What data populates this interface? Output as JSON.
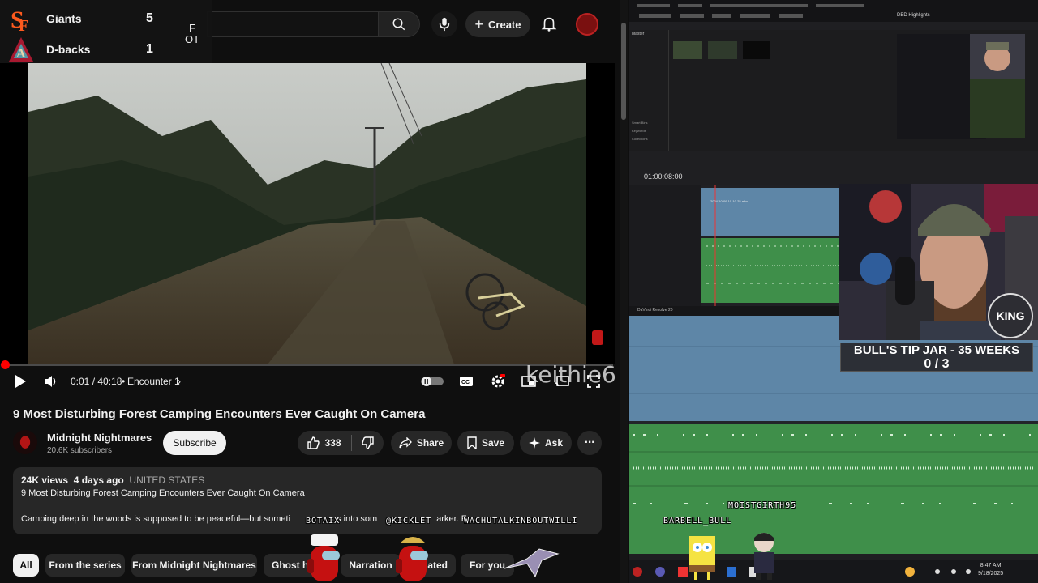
{
  "scoreboard": {
    "teams": [
      {
        "name": "Giants",
        "score": "5"
      },
      {
        "name": "D-backs",
        "score": "1"
      }
    ],
    "status_line1": "F",
    "status_line2": "OT"
  },
  "header": {
    "create_label": "Create"
  },
  "player": {
    "current_time": "0:01 / 40:18",
    "chapter": "Encounter 1",
    "progress_fraction": 0.0003,
    "watermark": "keithie6"
  },
  "video": {
    "title": "9 Most Disturbing Forest Camping Encounters Ever Caught On Camera",
    "channel_name": "Midnight Nightmares",
    "subscribers": "20.6K subscribers",
    "subscribe_label": "Subscribe",
    "likes": "338",
    "share_label": "Share",
    "save_label": "Save",
    "ask_label": "Ask"
  },
  "description": {
    "views": "24K views",
    "age": "4 days ago",
    "location": "UNITED STATES",
    "line2": "9 Most Disturbing Forest Camping Encounters Ever Caught On Camera",
    "line3_start": "Camping deep in the woods is supposed to be peaceful—but someti",
    "line3_mid": "s into som",
    "line3_end": "arker. F"
  },
  "chips": [
    "All",
    "From the series",
    "From Midnight Nightmares",
    "Ghost h",
    "Narration",
    "ated",
    "For you"
  ],
  "overlays": {
    "names": [
      "BOTAIX",
      "@KICKLET",
      "WACHUTALKINBOUTWILLI",
      "MOISTGIRTH95",
      "BARBELL_BULL"
    ]
  },
  "resolve": {
    "project_title": "DBD Highlights",
    "timecode": "01:00:08:00",
    "footer_label": "DaVinci Resolve 20",
    "pool_label": "Master",
    "side_items": [
      "Smart Bins",
      "Keywords",
      "Collections"
    ],
    "clip_label": "2024-10-09 10-10-25.mkv"
  },
  "stream": {
    "tip_jar_title": "BULL'S TIP JAR - 35 WEEKS",
    "tip_jar_count": "0 / 3",
    "badge": "KING"
  },
  "taskbar": {
    "time": "8:47 AM",
    "date": "9/18/2025"
  },
  "colors": {
    "youtube_red": "#ff0000",
    "resolve_audio_green": "#3f8f4a",
    "resolve_video_blue": "#5e86a7"
  }
}
